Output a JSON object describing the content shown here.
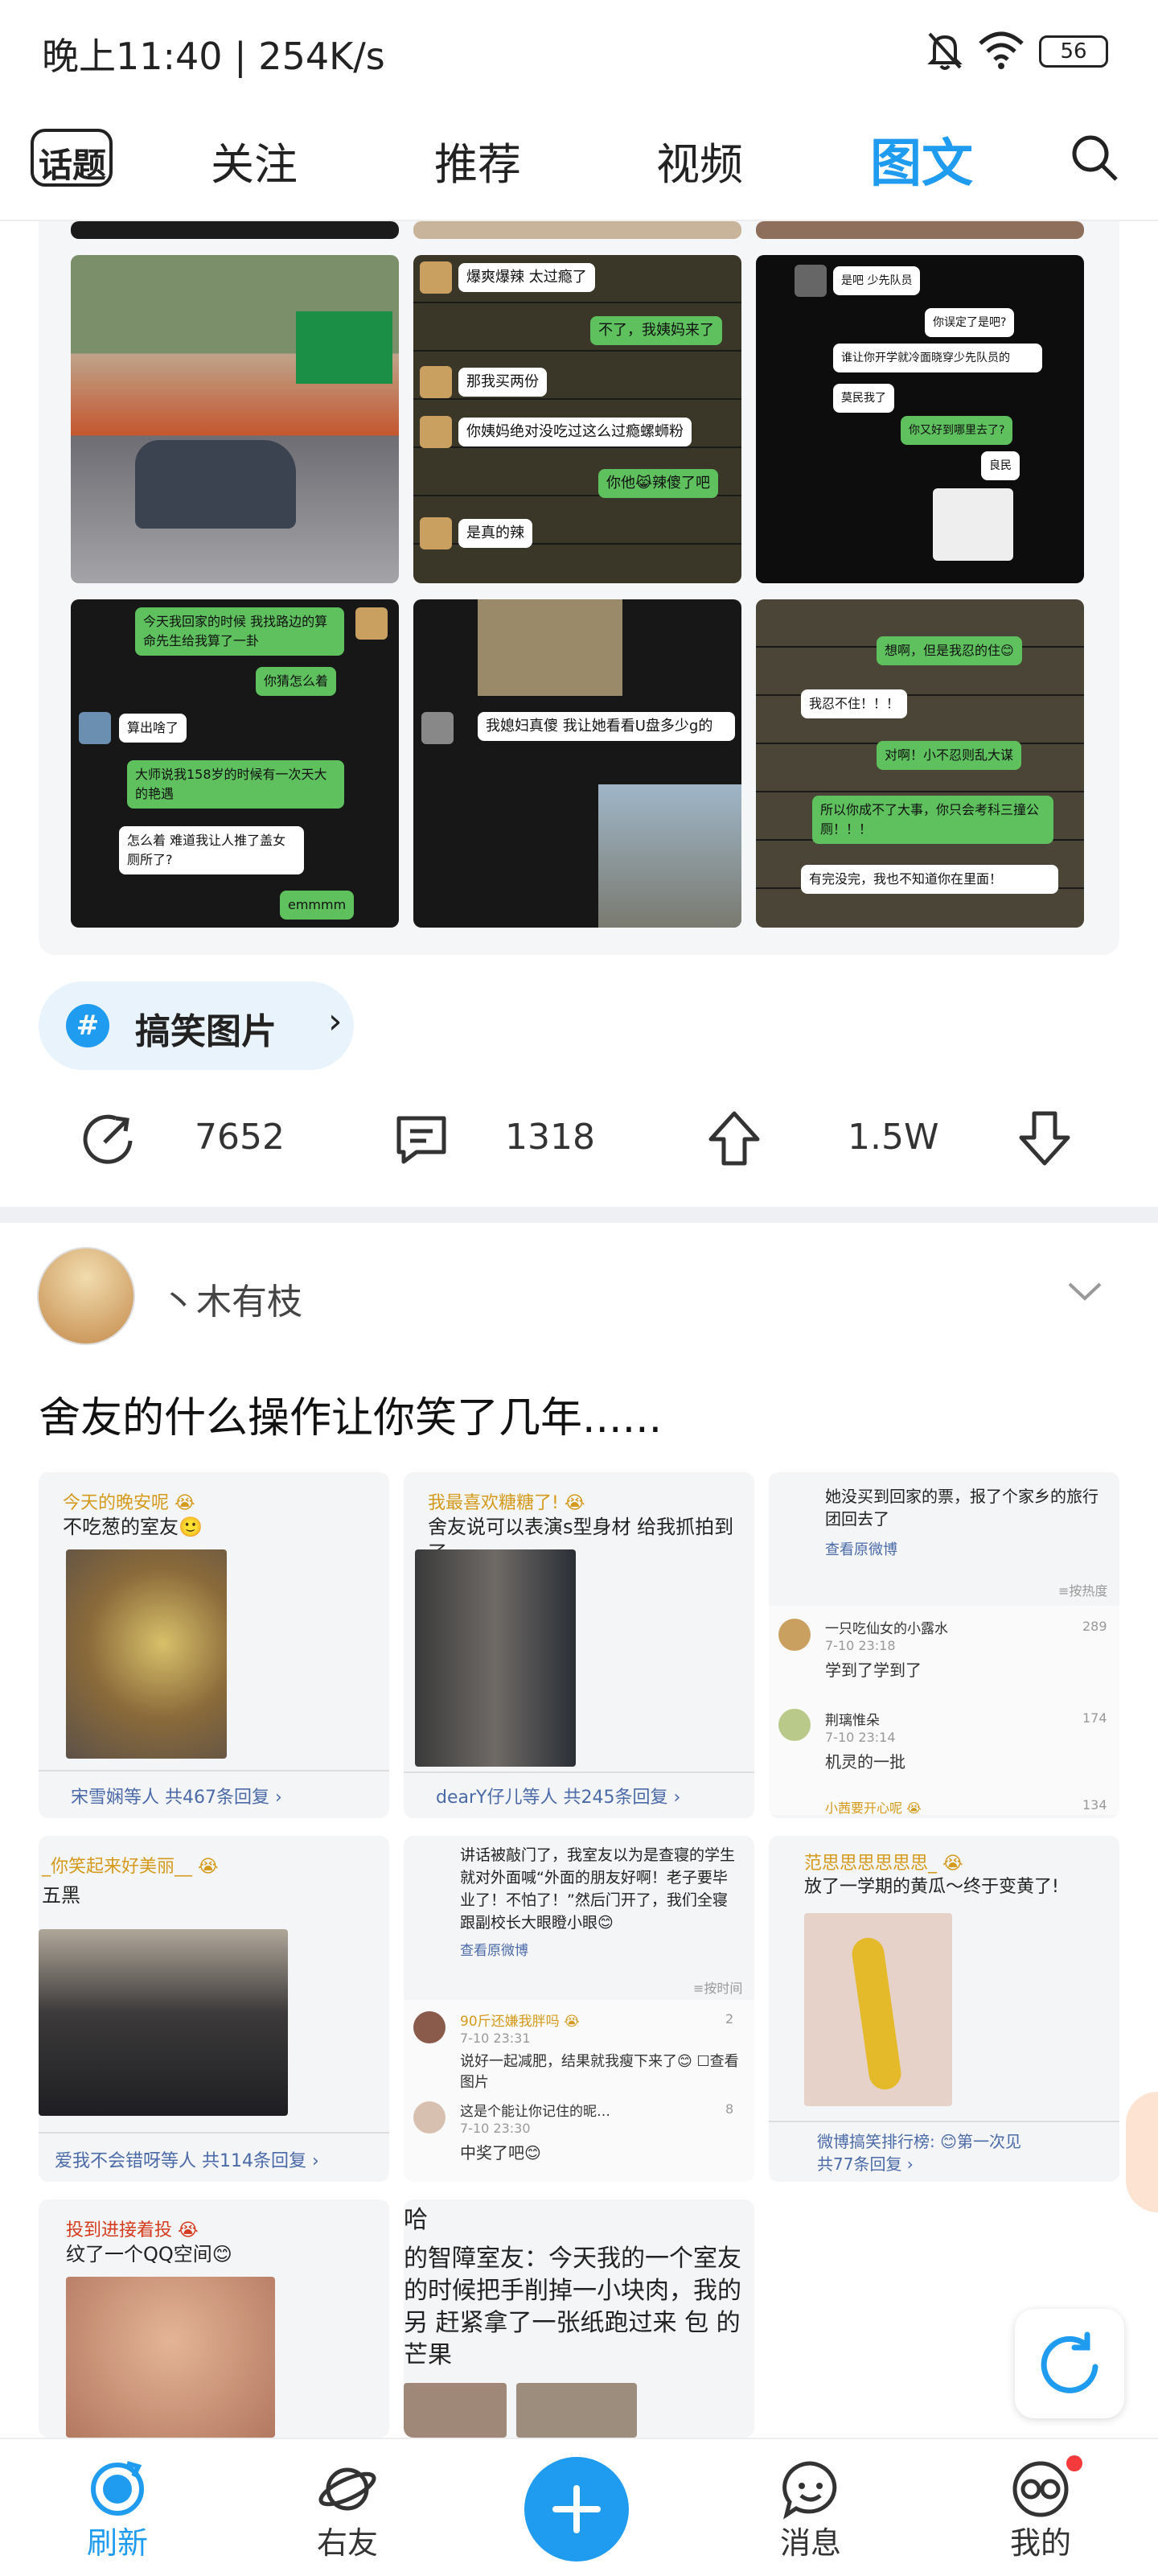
{
  "status_bar": {
    "time_speed": "晚上11:40 | 254K/s",
    "battery": "56"
  },
  "nav": {
    "tabs": [
      "话题",
      "关注",
      "推荐",
      "视频",
      "图文"
    ],
    "active": "图文"
  },
  "post1": {
    "images": {
      "cell2": {
        "lines": [
          "爆爽爆辣 太过瘾了",
          "不了，我姨妈来了",
          "那我买两份",
          "你姨妈绝对没吃过这么过瘾螺蛳粉",
          "你他😹辣傻了吧",
          "是真的辣"
        ]
      },
      "cell3": {
        "lines": [
          "是吧 少先队员",
          "你误定了是吧?",
          "谁让你开学就冷面晓穿少先队员的",
          "莫民我了",
          "你又好到哪里去了?",
          "良民"
        ]
      },
      "cell4": {
        "lines": [
          "今天我回家的时候 我找路边的算命先生给我算了一卦",
          "你猜怎么着",
          "算出啥了",
          "大师说我158岁的时候有一次天大的艳遇",
          "怎么着 难道我让人推了盖女厕所了?",
          "emmmm"
        ]
      },
      "cell5": {
        "lines": [
          "我媳妇真傻 我让她看看U盘多少g的"
        ]
      },
      "cell6": {
        "lines": [
          "想啊，但是我忍的住😊",
          "我忍不住！！！",
          "对啊！小不忍则乱大谋",
          "所以你成不了大事，你只会考科三撞公厕！！！",
          "有完没完，我也不知道你在里面！"
        ]
      }
    },
    "topic_tag": "搞笑图片",
    "stats": {
      "shares": "7652",
      "comments": "1318",
      "likes": "1.5W"
    }
  },
  "post2": {
    "username": "丶木有枝",
    "title": "舍友的什么操作让你笑了几年......",
    "cards": [
      {
        "user": "今天的晚安呢 😭",
        "text": "不吃葱的室友🙂",
        "foot": "宋雪娴等人  共467条回复 ›"
      },
      {
        "user": "我最喜欢糖糖了! 😭",
        "text": "舍友说可以表演s型身材 给我抓拍到了",
        "foot": "dearY仔儿等人  共245条回复 ›"
      },
      {
        "text": "她没买到回家的票，报了个家乡的旅行团回去了",
        "link": "查看原微博",
        "hot": "≡按热度",
        "comments": [
          {
            "name": "一只吃仙女的小露水",
            "time": "7-10 23:18",
            "text": "学到了学到了",
            "likes": "289"
          },
          {
            "name": "荆璃惟朵",
            "time": "7-10 23:14",
            "text": "机灵的一批",
            "likes": "174"
          },
          {
            "name": "小茜要开心呢 😭",
            "likes": "134"
          }
        ]
      },
      {
        "user": "_你笑起来好美丽__ 😭",
        "text": "五黑",
        "foot": "爱我不会错呀等人  共114条回复 ›"
      },
      {
        "text": "讲话被敲门了，我室友以为是查寝的学生就对外面喊“外面的朋友好啊！老子要毕业了！不怕了！”然后门开了，我们全寝跟副校长大眼瞪小眼😊",
        "link": "查看原微博",
        "hot": "≡按时间",
        "comments": [
          {
            "name": "90斤还嫌我胖吗 😭",
            "time": "7-10 23:31",
            "text": "说好一起减肥，结果就我瘦下来了😊 ☐查看图片",
            "likes": "2"
          },
          {
            "name": "这是个能让你记住的昵…",
            "time": "7-10 23:30",
            "text": "中奖了吧😊",
            "likes": "8"
          }
        ]
      },
      {
        "user": "范思思思思思思_ 😭",
        "text": "放了一学期的黄瓜～终于变黄了!",
        "foot": "微博搞笑排行榜: 😊第一次见",
        "foot2": "共77条回复 ›"
      },
      {
        "user": "投到进接着投 😭",
        "text": "纹了一个QQ空间😊"
      },
      {
        "text": "的智障室友：今天我的一个室友 的时候把手削掉一小块肉，我的另 赶紧拿了一张纸跑过来     包 的芒果",
        "prefix": "哈"
      }
    ]
  },
  "bottom_nav": {
    "items": [
      "刷新",
      "右友",
      "消息",
      "我的"
    ]
  }
}
